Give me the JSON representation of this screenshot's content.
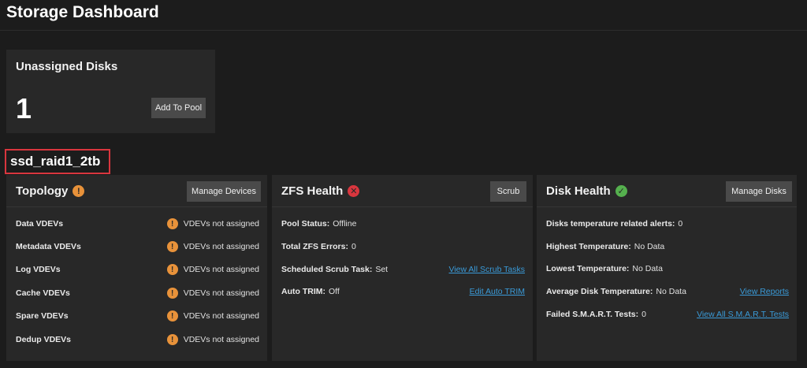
{
  "page": {
    "title": "Storage Dashboard"
  },
  "unassigned": {
    "title": "Unassigned Disks",
    "count": "1",
    "add_button": "Add To Pool"
  },
  "pool": {
    "name": "ssd_raid1_2tb"
  },
  "topology": {
    "title": "Topology",
    "button": "Manage Devices",
    "rows": [
      {
        "label": "Data VDEVs",
        "value": "VDEVs not assigned"
      },
      {
        "label": "Metadata VDEVs",
        "value": "VDEVs not assigned"
      },
      {
        "label": "Log VDEVs",
        "value": "VDEVs not assigned"
      },
      {
        "label": "Cache VDEVs",
        "value": "VDEVs not assigned"
      },
      {
        "label": "Spare VDEVs",
        "value": "VDEVs not assigned"
      },
      {
        "label": "Dedup VDEVs",
        "value": "VDEVs not assigned"
      }
    ]
  },
  "zfs": {
    "title": "ZFS Health",
    "button": "Scrub",
    "rows": [
      {
        "label": "Pool Status:",
        "value": "Offline",
        "link": ""
      },
      {
        "label": "Total ZFS Errors:",
        "value": "0",
        "link": ""
      },
      {
        "label": "Scheduled Scrub Task:",
        "value": "Set",
        "link": "View All Scrub Tasks"
      },
      {
        "label": "Auto TRIM:",
        "value": "Off",
        "link": "Edit Auto TRIM"
      }
    ]
  },
  "disk": {
    "title": "Disk Health",
    "button": "Manage Disks",
    "rows": [
      {
        "label": "Disks temperature related alerts:",
        "value": "0",
        "link": ""
      },
      {
        "label": "Highest Temperature:",
        "value": "No Data",
        "link": ""
      },
      {
        "label": "Lowest Temperature:",
        "value": "No Data",
        "link": ""
      },
      {
        "label": "Average Disk Temperature:",
        "value": "No Data",
        "link": "View Reports"
      },
      {
        "label": "Failed S.M.A.R.T. Tests:",
        "value": "0",
        "link": "View All S.M.A.R.T. Tests"
      }
    ]
  },
  "colors": {
    "warning": "#e8923a",
    "error": "#d9363e",
    "ok": "#55b04e",
    "link": "#3a9bd9"
  },
  "icons": {
    "topology_status": "warning-icon",
    "zfs_status": "error-icon",
    "disk_status": "check-circle-icon",
    "vdev_status": "warning-icon"
  }
}
